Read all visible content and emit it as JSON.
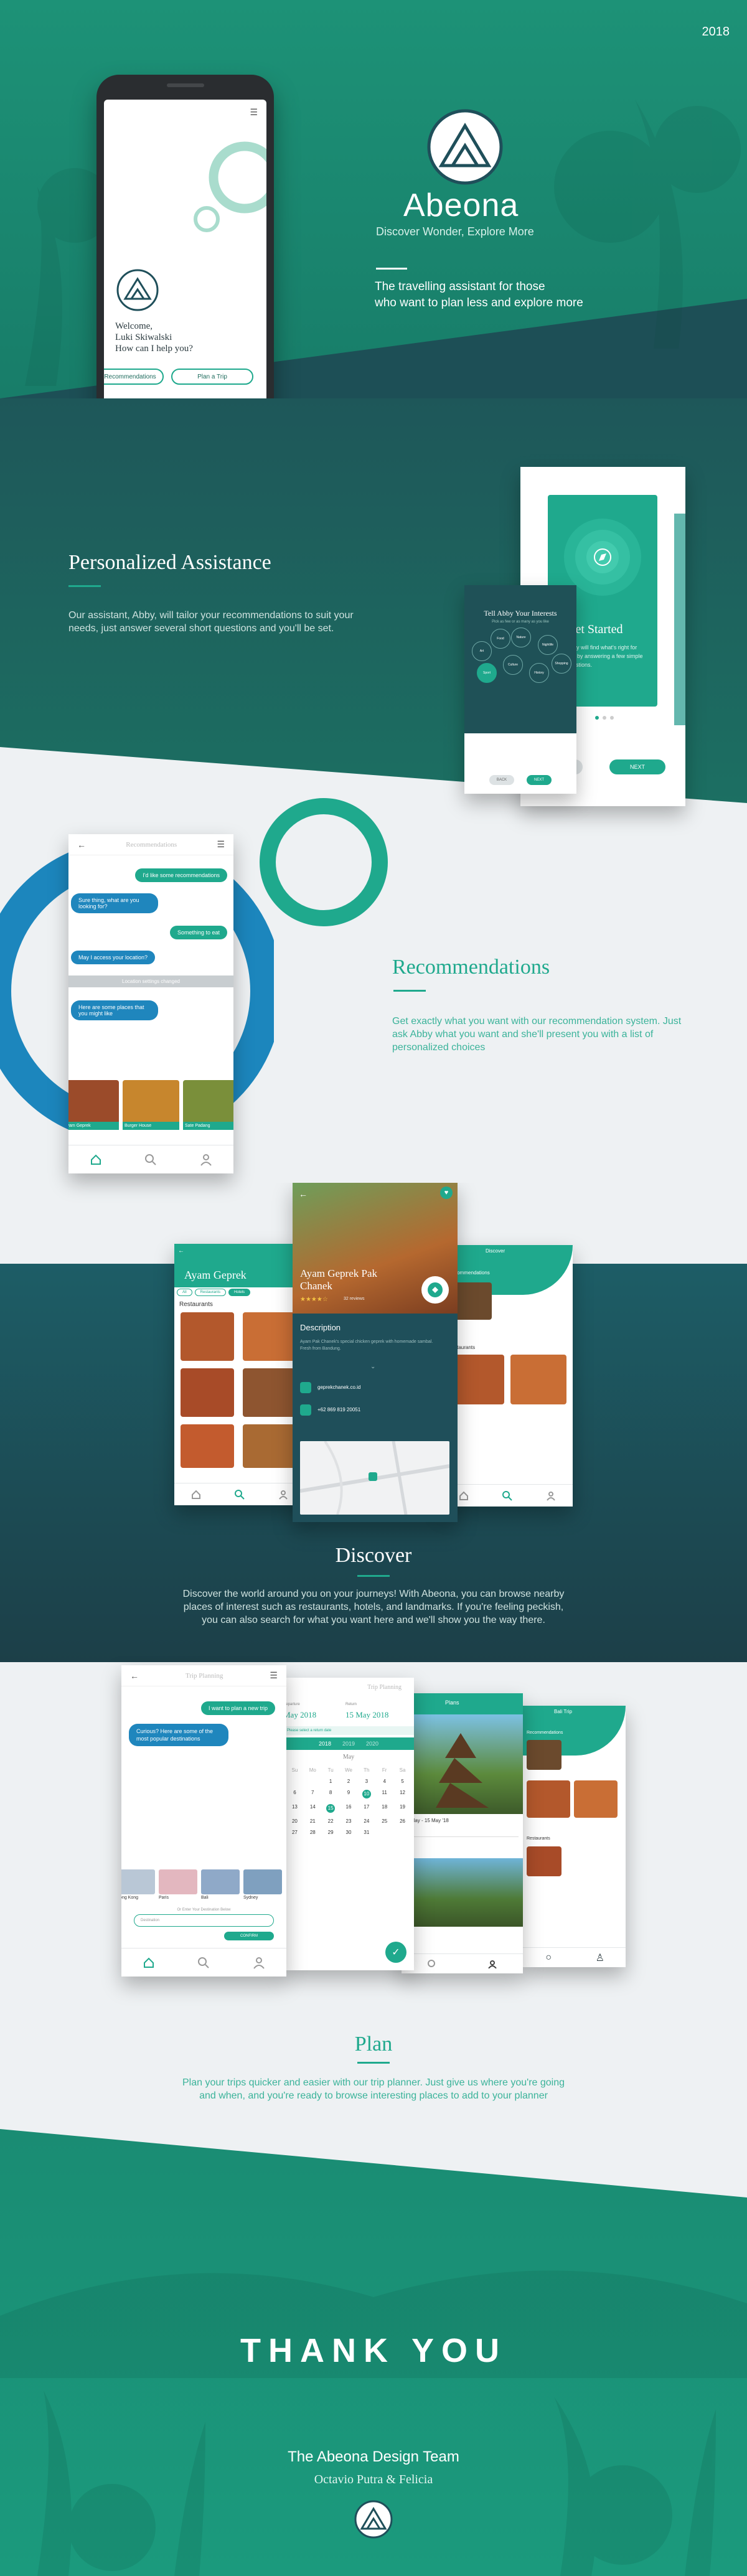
{
  "hero": {
    "year": "2018",
    "brand": "Abeona",
    "tagline": "Discover Wonder, Explore More",
    "description_line1": "The travelling assistant for those",
    "description_line2": "who want to plan less and explore more",
    "phone": {
      "welcome": "Welcome,",
      "user": "Luki Skiwalski",
      "question": "How can I help you?",
      "chip_recommendations": "Recommendations",
      "chip_plan": "Plan a Trip"
    }
  },
  "personalized": {
    "title": "Personalized Assistance",
    "body": "Our assistant, Abby, will tailor your recommendations to suit your needs, just answer several short questions and you'll be set.",
    "interests_title": "Tell Abby Your Interests",
    "interests_subtitle": "Pick as few or as many as you like",
    "interests": [
      "Art",
      "Food",
      "Nature",
      "Nightlife",
      "Sport",
      "Culture",
      "History",
      "Shopping"
    ],
    "get_started": "Get Started",
    "get_started_body": "Abby will find what's right for you by answering a few simple questions.",
    "back_label": "BACK",
    "next_label": "NEXT"
  },
  "recommendations": {
    "title": "Recommendations",
    "body": "Get exactly what you want with our recommendation system. Just ask Abby what you want and she'll present you with a list of personalized choices",
    "header": "Recommendations",
    "chat": [
      {
        "side": "right",
        "text": "I'd like some recommendations"
      },
      {
        "side": "left",
        "text": "Sure thing, what are you looking for?"
      },
      {
        "side": "right",
        "text": "Something to eat"
      },
      {
        "side": "left",
        "text": "May I access your location?"
      },
      {
        "side": "system",
        "text": "Location settings changed"
      },
      {
        "side": "left",
        "text": "Here are some places that you might like"
      }
    ],
    "cards": [
      "Ayam Geprek",
      "Burger House",
      "Sate Padang"
    ]
  },
  "discover": {
    "title": "Discover",
    "body": "Discover the world around you on your journeys! With Abeona, you can browse nearby places of interest such as restaurants, hotels, and landmarks. If you're feeling peckish, you can also search for what you want here and we'll show you the way there.",
    "search_result": "Ayam Geprek",
    "filters": [
      "All",
      "Restaurants",
      "Hotels"
    ],
    "restaurants_label": "Restaurants",
    "detail_title_line1": "Ayam Geprek Pak",
    "detail_title_line2": "Chanek",
    "rating": "4.5",
    "reviews": "32 reviews",
    "description_label": "Description",
    "description_text": "Ayam Pak Chanek's special chicken geprek with homemade sambal. Fresh from Bandung.",
    "website": "geprekchanek.co.id",
    "phone": "+62 869 819 20051",
    "right_header": "Discover",
    "right_section1": "Recommendations",
    "right_section2": "Restaurants"
  },
  "plan": {
    "title": "Plan",
    "body": "Plan your trips quicker and easier with our trip planner. Just give us where you're going and when, and you're ready to browse interesting places to add to your planner",
    "header": "Trip Planning",
    "chat_user": "I want to plan a new trip",
    "chat_bot": "Curious? Here are some of the most popular destinations",
    "destinations": [
      "Hong Kong",
      "Paris",
      "Bali",
      "Sydney"
    ],
    "enter_hint": "Or Enter Your Destination Below",
    "input_placeholder": "Destination",
    "confirm": "CONFIRM",
    "departure_label": "Departure",
    "departure_date": "May 2018",
    "return_label": "Return",
    "return_date": "15 May 2018",
    "calendar_hint": "Please select a return date",
    "calendar_year": "2018",
    "calendar_years": [
      "2018",
      "2019",
      "2020"
    ],
    "calendar_month": "May",
    "weekdays": [
      "Su",
      "Mo",
      "Tu",
      "We",
      "Th",
      "Fr",
      "Sa"
    ],
    "days": [
      "",
      "",
      "1",
      "2",
      "3",
      "4",
      "5",
      "6",
      "7",
      "8",
      "9",
      "10",
      "11",
      "12",
      "13",
      "14",
      "15",
      "16",
      "17",
      "18",
      "19",
      "20",
      "21",
      "22",
      "23",
      "24",
      "25",
      "26",
      "27",
      "28",
      "29",
      "30",
      "31",
      "",
      ""
    ],
    "selected_days": [
      "10",
      "15"
    ],
    "plan_header": "Plans",
    "plan_dates": "1 May - 15 May '18",
    "bali_header": "Bali Trip",
    "bali_sections": [
      "Recommendations",
      "Restaurants"
    ]
  },
  "footer": {
    "thanks": "THANK YOU",
    "team": "The Abeona Design Team",
    "members": "Octavio Putra & Felicia"
  }
}
